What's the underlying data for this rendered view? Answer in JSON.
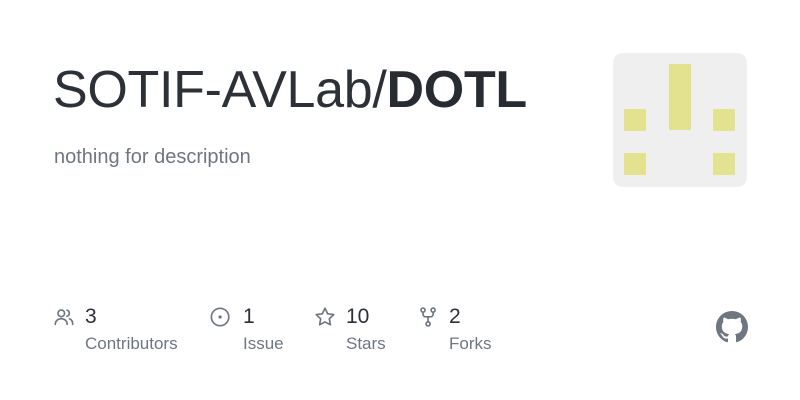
{
  "repo": {
    "owner": "SOTIF-AVLab/",
    "name": "DOTL",
    "description": "nothing for description"
  },
  "avatar": {
    "background": "#efefef",
    "block_color": "#e3e38f"
  },
  "stats": [
    {
      "icon": "people-icon",
      "value": "3",
      "label": "Contributors"
    },
    {
      "icon": "issue-icon",
      "value": "1",
      "label": "Issue"
    },
    {
      "icon": "star-icon",
      "value": "10",
      "label": "Stars"
    },
    {
      "icon": "fork-icon",
      "value": "2",
      "label": "Forks"
    }
  ],
  "colors": {
    "text": "#2c3138",
    "muted": "#6e7781",
    "icon": "#6e7781"
  },
  "brand_icon": "github-icon"
}
